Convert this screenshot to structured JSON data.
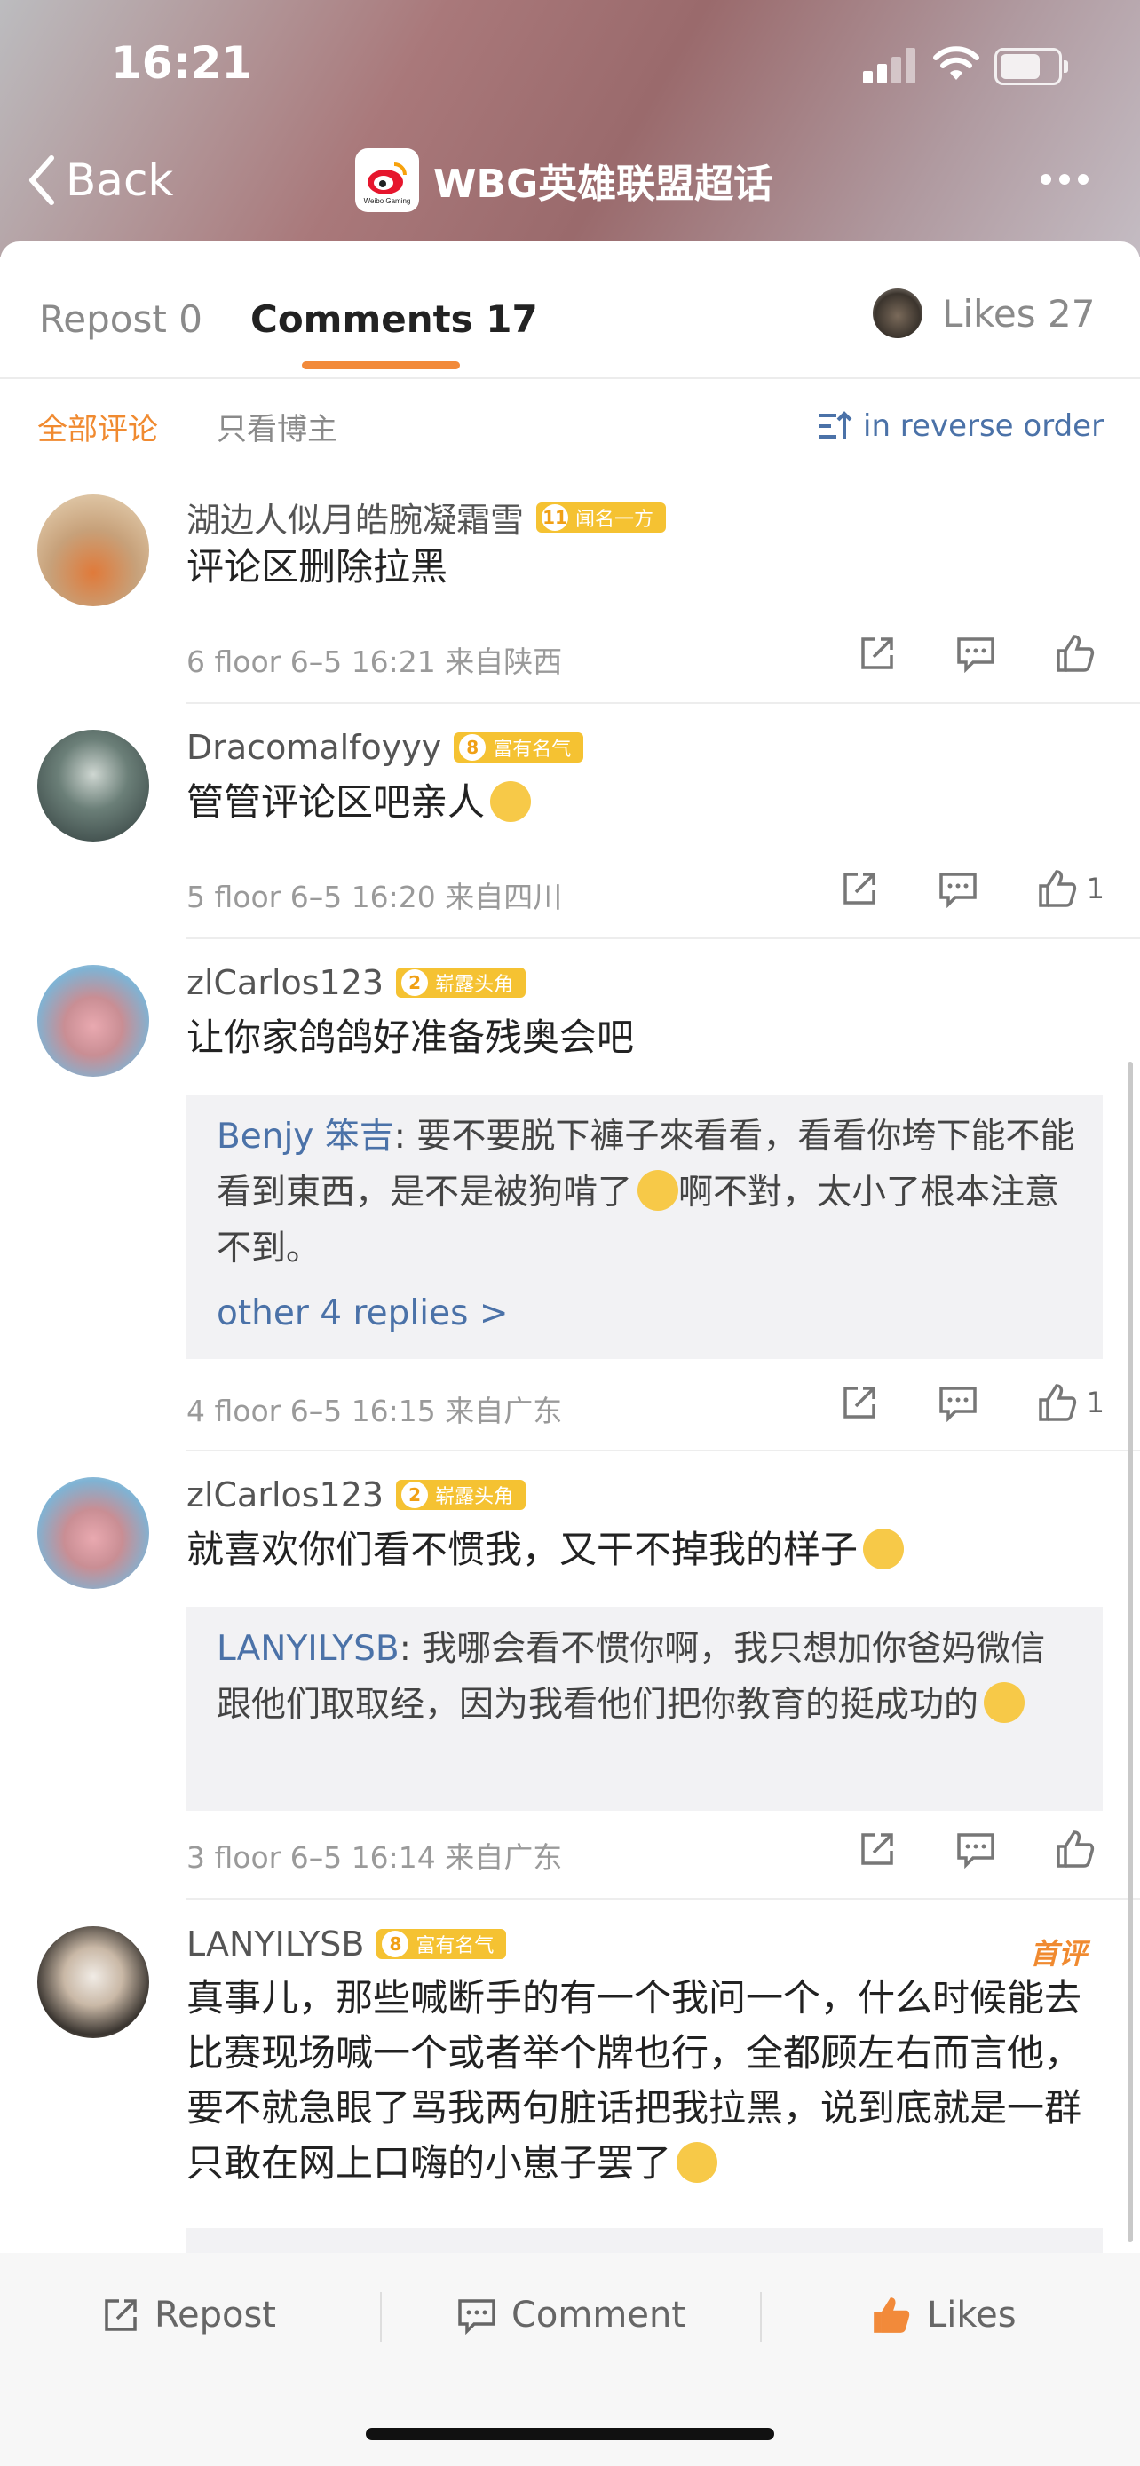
{
  "status": {
    "time": "16:21"
  },
  "nav": {
    "back_label": "Back",
    "title": "WBG英雄联盟超话",
    "logo_text": "Weibo Gaming"
  },
  "tabs": {
    "repost": "Repost 0",
    "comments": "Comments 17",
    "likes": "Likes 27"
  },
  "filters": {
    "all": "全部评论",
    "host_only": "只看博主",
    "order": "in reverse order"
  },
  "comments": [
    {
      "user": "湖边人似月皓腕凝霜雪",
      "badge_level": "11",
      "badge_text": "闻名一方",
      "text": "评论区删除拉黑",
      "meta": "6 floor 6–5 16:21 来自陕西",
      "likes": ""
    },
    {
      "user": "Dracomalfoyyy",
      "badge_level": "8",
      "badge_text": "富有名气",
      "text": "管管评论区吧亲人",
      "meta": "5 floor 6–5 16:20 来自四川",
      "likes": "1"
    },
    {
      "user": "zlCarlos123",
      "badge_level": "2",
      "badge_text": "崭露头角",
      "text": "让你家鸽鸽好准备残奥会吧",
      "reply_user": "Benjy 笨吉",
      "reply_text": ": 要不要脱下褲子來看看，看看你垮下能不能看到東西，是不是被狗啃了",
      "reply_text2": "啊不對，太小了根本注意不到。",
      "more_replies": "other 4 replies >",
      "meta": "4 floor 6–5 16:15 来自广东",
      "likes": "1"
    },
    {
      "user": "zlCarlos123",
      "badge_level": "2",
      "badge_text": "崭露头角",
      "text": "就喜欢你们看不惯我，又干不掉我的样子",
      "reply_user": "LANYILYSB",
      "reply_text": ": 我哪会看不惯你啊，我只想加你爸妈微信跟他们取取经，因为我看他们把你教育的挺成功的",
      "meta": "3 floor 6–5 16:14 来自广东",
      "likes": ""
    },
    {
      "user": "LANYILYSB",
      "badge_level": "8",
      "badge_text": "富有名气",
      "first_tag": "首评",
      "text": "真事儿，那些喊断手的有一个我问一个，什么时候能去比赛现场喊一个或者举个牌也行，全都顾左右而言他，要不就急眼了骂我两句脏话把我拉黑，说到底就是一群只敢在网上口嗨的小崽子罢了"
    }
  ],
  "bottom_bar": {
    "repost": "Repost",
    "comment": "Comment",
    "likes": "Likes"
  }
}
